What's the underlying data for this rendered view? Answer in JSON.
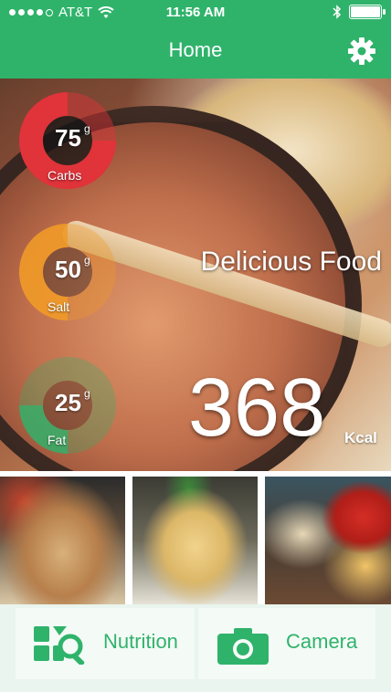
{
  "status_bar": {
    "carrier": "AT&T",
    "time": "11:56 AM",
    "icons": [
      "signal-dots-icon",
      "wifi-icon",
      "bluetooth-icon",
      "battery-icon"
    ]
  },
  "nav": {
    "title": "Home",
    "settings_icon": "gear-icon"
  },
  "hero": {
    "title": "Delicious Food",
    "calories": "368",
    "calories_unit": "Kcal",
    "stats": [
      {
        "value": "75",
        "unit": "g",
        "label": "Carbs",
        "color": "#e0333a"
      },
      {
        "value": "50",
        "unit": "g",
        "label": "Salt",
        "color": "#f09a28"
      },
      {
        "value": "25",
        "unit": "g",
        "label": "Fat",
        "color": "#2fb36b"
      }
    ]
  },
  "thumbnails": [
    {
      "subject": "grilled chicken dish"
    },
    {
      "subject": "spaghetti dish"
    },
    {
      "subject": "cheese and apple plate"
    }
  ],
  "tabbar": {
    "tabs": [
      {
        "label": "Nutrition",
        "icon": "nutrition-search-icon"
      },
      {
        "label": "Camera",
        "icon": "camera-icon"
      }
    ]
  },
  "colors": {
    "brand": "#2fb36b",
    "carbs": "#e0333a",
    "salt": "#f09a28",
    "fat": "#2fb36b"
  }
}
